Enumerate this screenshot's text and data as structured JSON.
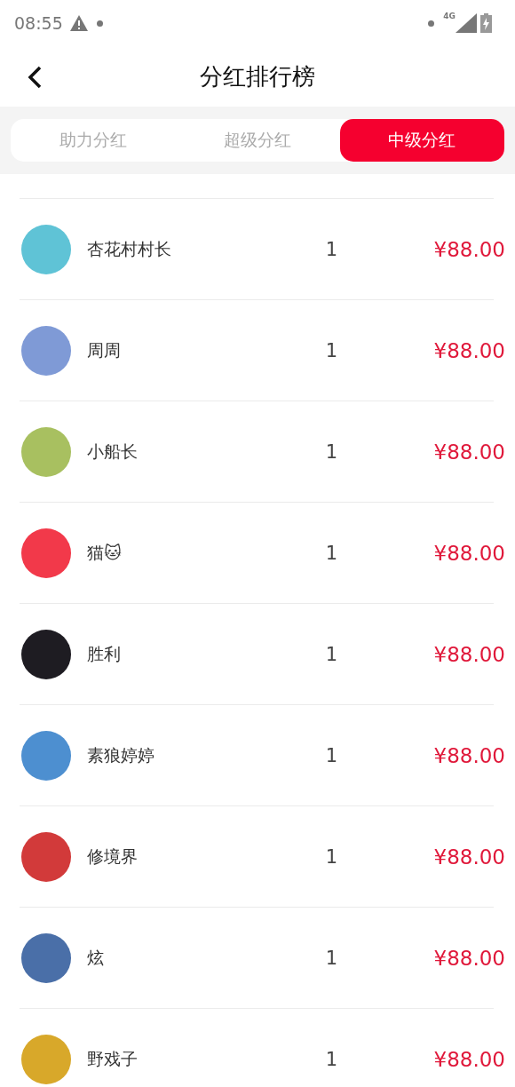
{
  "status_bar": {
    "time": "08:55",
    "network": "4G"
  },
  "header": {
    "title": "分红排行榜"
  },
  "tabs": [
    {
      "label": "助力分红",
      "selected": false
    },
    {
      "label": "超级分红",
      "selected": false
    },
    {
      "label": "中级分红",
      "selected": true
    }
  ],
  "ranking": [
    {
      "name": "杏花村村长",
      "count": "1",
      "amount": "¥88.00",
      "color": "#5fc3d6"
    },
    {
      "name": "周周",
      "count": "1",
      "amount": "¥88.00",
      "color": "#7f9ad6"
    },
    {
      "name": "小船长",
      "count": "1",
      "amount": "¥88.00",
      "color": "#a8c060"
    },
    {
      "name": "猫🐱",
      "count": "1",
      "amount": "¥88.00",
      "color": "#f2394a"
    },
    {
      "name": "胜利",
      "count": "1",
      "amount": "¥88.00",
      "color": "#1e1c22"
    },
    {
      "name": "素狼婷婷",
      "count": "1",
      "amount": "¥88.00",
      "color": "#4d8fd0"
    },
    {
      "name": "修境界",
      "count": "1",
      "amount": "¥88.00",
      "color": "#d23a3a"
    },
    {
      "name": "炫",
      "count": "1",
      "amount": "¥88.00",
      "color": "#4a6fa8"
    },
    {
      "name": "野戏子",
      "count": "1",
      "amount": "¥88.00",
      "color": "#d8a82a"
    }
  ]
}
